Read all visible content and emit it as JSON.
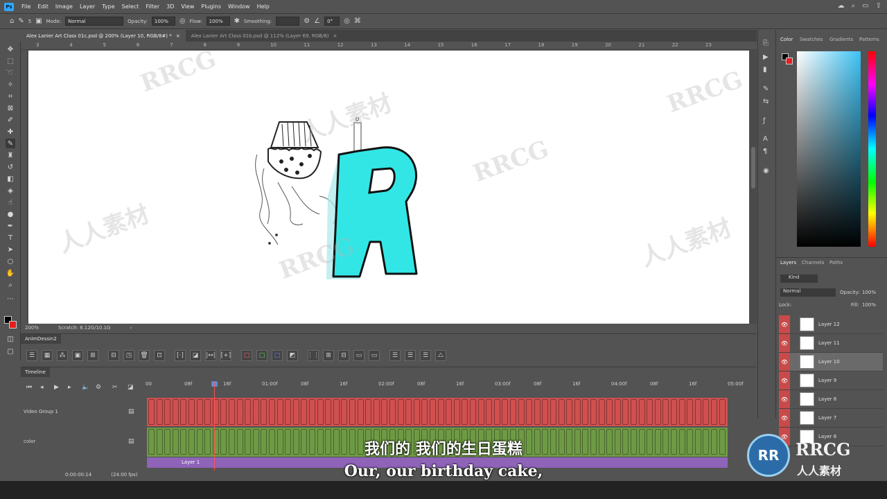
{
  "menu": [
    "File",
    "Edit",
    "Image",
    "Layer",
    "Type",
    "Select",
    "Filter",
    "3D",
    "View",
    "Plugins",
    "Window",
    "Help"
  ],
  "options": {
    "brush_size": "5",
    "mode_label": "Mode:",
    "mode_value": "Normal",
    "opacity_label": "Opacity:",
    "opacity_value": "100%",
    "flow_label": "Flow:",
    "flow_value": "100%",
    "smoothing_label": "Smoothing:",
    "angle_value": "0°"
  },
  "tabs": [
    {
      "label": "Alex Lanier Art Class 01c.psd @ 200% (Layer 10, RGB/8#) *"
    },
    {
      "label": "Alex Lanier Art Class 01b.psd @ 112% (Layer 69, RGB/8)"
    }
  ],
  "ruler_numbers": [
    "3",
    "4",
    "5",
    "6",
    "7",
    "8",
    "9",
    "10",
    "11",
    "12",
    "13",
    "14",
    "15",
    "16",
    "17",
    "18",
    "19",
    "20",
    "21",
    "22",
    "23"
  ],
  "status": {
    "zoom": "200%",
    "scratch": "Scratch: 8.12G/10.1G"
  },
  "anim_panel": {
    "title": "AnimDessin2"
  },
  "timeline": {
    "title": "Timeline",
    "ticks": [
      "00",
      "08f",
      "16f",
      "01:00f",
      "08f",
      "16f",
      "02:00f",
      "08f",
      "16f",
      "03:00f",
      "08f",
      "16f",
      "04:00f",
      "08f",
      "16f",
      "05:00f"
    ],
    "tracks": [
      {
        "name": "Video Group 1"
      },
      {
        "name": "color"
      }
    ],
    "clip_label": "Layer 1",
    "timecode": "0:00:00:14",
    "fps": "(24.00 fps)"
  },
  "color_panel": {
    "tabs": [
      "Color",
      "Swatches",
      "Gradients",
      "Patterns"
    ],
    "foreground": "#000000",
    "background": "#e61e1e"
  },
  "layers_panel": {
    "tabs": [
      "Layers",
      "Channels",
      "Paths"
    ],
    "filter": "Kind",
    "blend_mode": "Normal",
    "opacity_label": "Opacity:",
    "opacity_value": "100%",
    "lock_label": "Lock:",
    "fill_label": "Fill:",
    "fill_value": "100%",
    "layers": [
      "Layer 12",
      "Layer 11",
      "Layer 10",
      "Layer 9",
      "Layer 8",
      "Layer 7",
      "Layer 6"
    ],
    "selected": "Layer 10"
  },
  "subtitles": {
    "zh": "我们的 我们的生日蛋糕",
    "en": "Our, our birthday cake,"
  },
  "watermark": {
    "text_a": "RRCG",
    "text_b": "人人素材"
  },
  "logo": {
    "mark": "RR",
    "title": "RRCG",
    "subtitle": "人人素材"
  },
  "colors": {
    "letter_fill": "#33e6e6",
    "track_red": "#d05050",
    "track_green": "#6f9a45",
    "track_purple": "#8e63b8"
  }
}
